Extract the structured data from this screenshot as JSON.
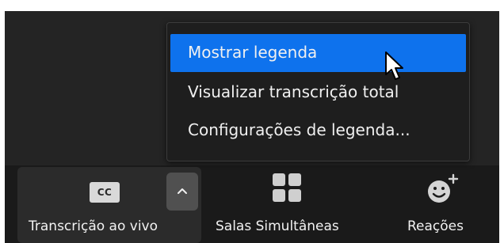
{
  "caption_menu": {
    "items": [
      {
        "label": "Mostrar legenda",
        "active": true
      },
      {
        "label": "Visualizar transcrição total",
        "active": false
      },
      {
        "label": "Configurações de legenda...",
        "active": false
      }
    ],
    "highlight_color": "#0e72ed"
  },
  "toolbar": {
    "live_transcript": {
      "icon": "closed-captions-icon",
      "icon_text": "CC",
      "label": "Transcrição ao vivo",
      "caret_icon": "chevron-up-icon"
    },
    "breakout_rooms": {
      "icon": "grid-icon",
      "label": "Salas Simultâneas"
    },
    "reactions": {
      "icon": "emoji-add-icon",
      "label": "Reações"
    }
  },
  "colors": {
    "app_background": "#242424",
    "toolbar_background": "#1a1a1a",
    "menu_background": "#1e1e1e"
  }
}
